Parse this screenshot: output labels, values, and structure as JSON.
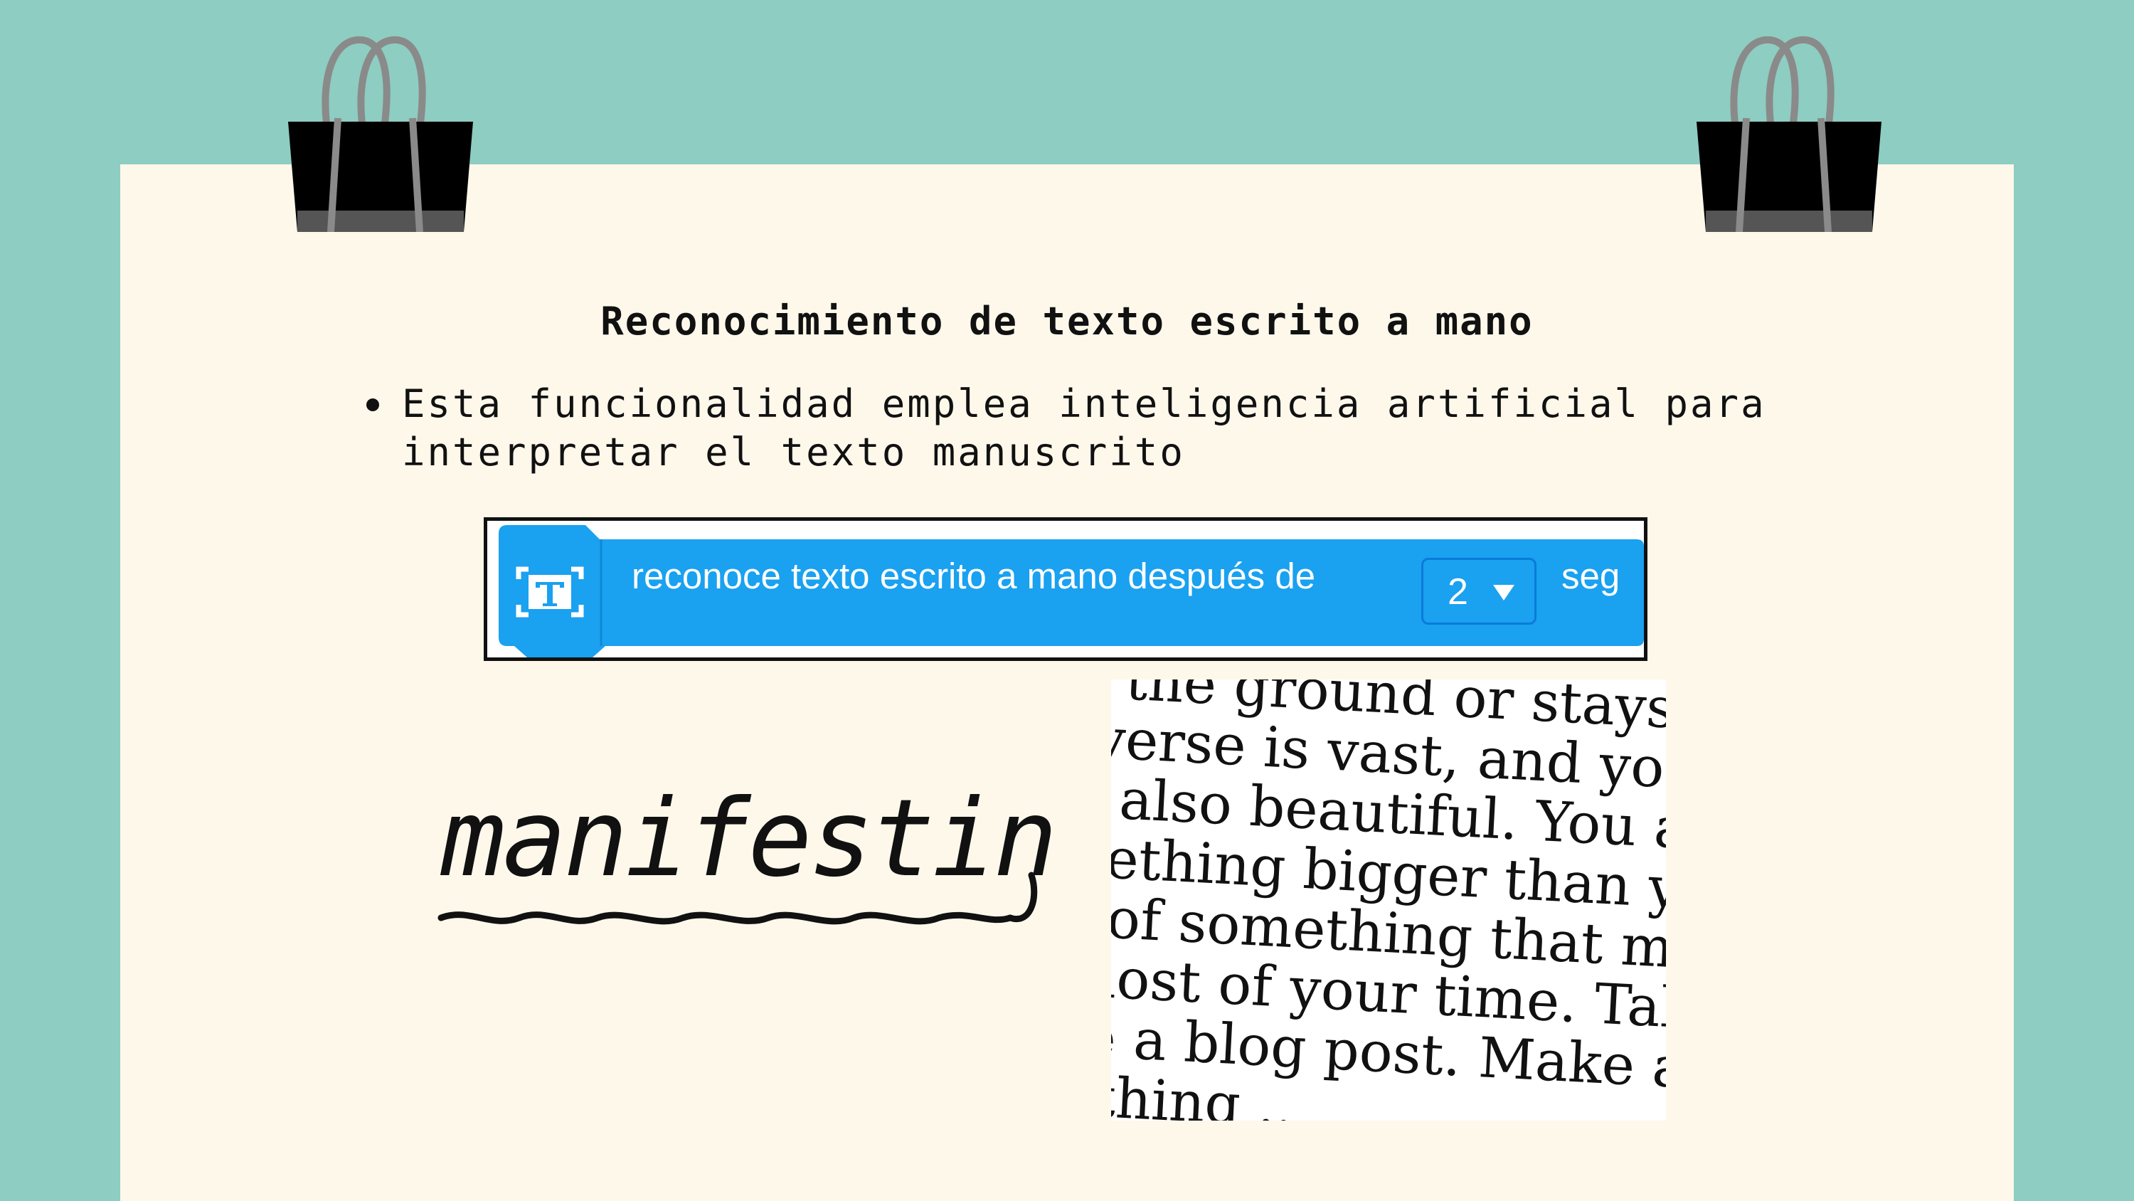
{
  "slide": {
    "title": "Reconocimiento de texto escrito a mano",
    "bullets": [
      "Esta funcionalidad emplea inteligencia artificial para interpretar el texto manuscrito"
    ]
  },
  "code_block": {
    "icon": "text-recognition-icon",
    "label": "reconoce texto escrito a mano después de",
    "dropdown_value": "2",
    "unit": "seg",
    "color": "#1aa1f0"
  },
  "handwriting_sample": {
    "text": "manifesting"
  },
  "printed_sample": {
    "lines": [
      "s the ground or stays",
      "iverse is vast, and you",
      "s also beautiful. You a",
      "nething bigger than yo",
      "t of something that ma",
      "most of your time. Tak",
      "te a blog post. Make a",
      "nthing ..."
    ]
  },
  "colors": {
    "background": "#8ecdc1",
    "paper": "#fef8eb",
    "block_blue": "#1aa1f0"
  }
}
